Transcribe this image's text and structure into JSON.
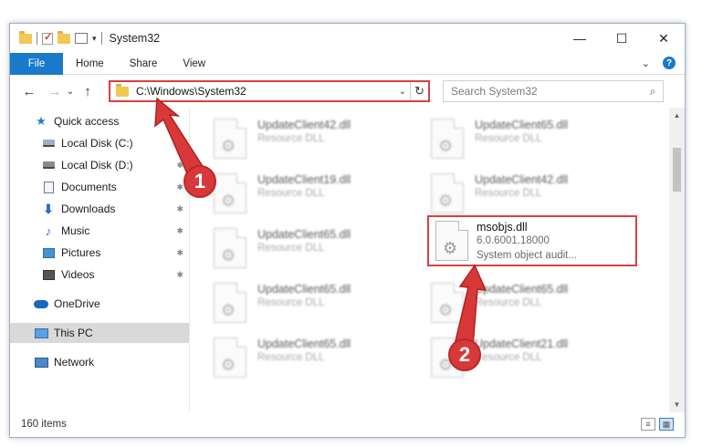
{
  "window": {
    "title": "System32",
    "controls": {
      "minimize": "—",
      "maximize": "☐",
      "close": "✕"
    }
  },
  "ribbon": {
    "file_tab": "File",
    "tabs": [
      "Home",
      "Share",
      "View"
    ],
    "help": "?"
  },
  "nav": {
    "back": "←",
    "forward": "→",
    "recent": "⌄",
    "up": "↑",
    "address": "C:\\Windows\\System32",
    "refresh": "↻",
    "dropdown": "⌄",
    "search_placeholder": "Search System32",
    "search_icon": "⌕"
  },
  "sidebar": {
    "items": [
      {
        "label": "Quick access",
        "icon": "star-icon"
      },
      {
        "label": "Local Disk (C:)",
        "icon": "drive-icon",
        "pinned": true
      },
      {
        "label": "Local Disk (D:)",
        "icon": "drive-icon",
        "pinned": true
      },
      {
        "label": "Documents",
        "icon": "documents-icon",
        "pinned": true
      },
      {
        "label": "Downloads",
        "icon": "downloads-icon",
        "pinned": true
      },
      {
        "label": "Music",
        "icon": "music-icon",
        "pinned": true
      },
      {
        "label": "Pictures",
        "icon": "pictures-icon",
        "pinned": true
      },
      {
        "label": "Videos",
        "icon": "videos-icon",
        "pinned": true
      },
      {
        "label": "OneDrive",
        "icon": "cloud-icon"
      },
      {
        "label": "This PC",
        "icon": "computer-icon",
        "selected": true
      },
      {
        "label": "Network",
        "icon": "network-icon"
      }
    ]
  },
  "files": [
    {
      "name": "UpdateClient42.dll",
      "type": "Resource DLL"
    },
    {
      "name": "UpdateClient65.dll",
      "type": "Resource DLL"
    },
    {
      "name": "UpdateClient19.dll",
      "type": "Resource DLL"
    },
    {
      "name": "UpdateClient42.dll",
      "type": "Resource DLL"
    },
    {
      "name": "UpdateClient65.dll",
      "type": "Resource DLL"
    },
    {
      "name": "msobjs.dll",
      "version": "6.0.6001.18000",
      "description": "System object audit...",
      "highlighted": true
    },
    {
      "name": "UpdateClient65.dll",
      "type": "Resource DLL"
    },
    {
      "name": "UpdateClient65.dll",
      "type": "Resource DLL"
    },
    {
      "name": "UpdateClient65.dll",
      "type": "Resource DLL"
    },
    {
      "name": "UpdateClient21.dll",
      "type": "Resource DLL"
    }
  ],
  "status": {
    "item_count": "160 items"
  },
  "annotations": {
    "step1": "1",
    "step2": "2",
    "color": "#d93838"
  }
}
